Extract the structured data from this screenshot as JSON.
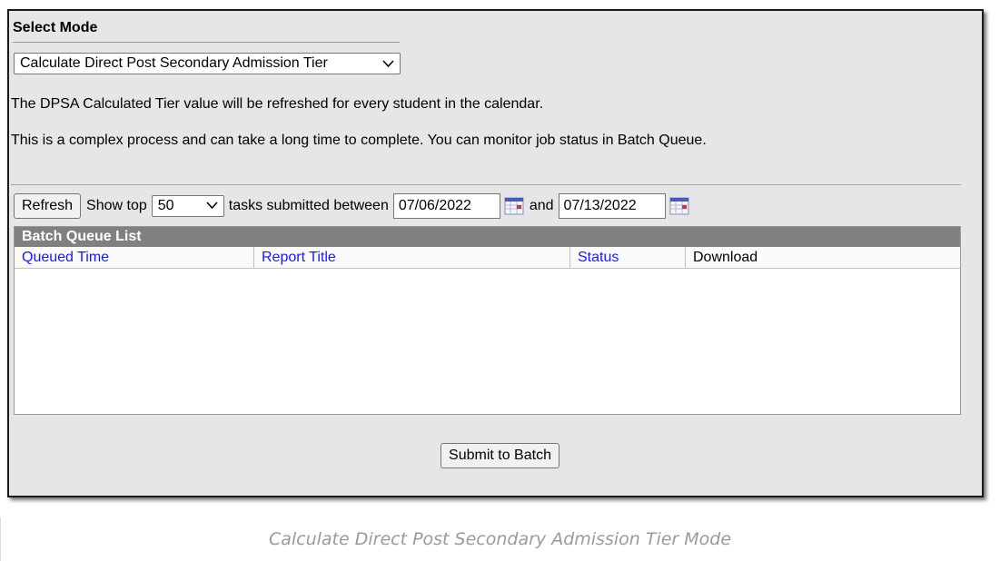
{
  "mode": {
    "header": "Select Mode",
    "selected": "Calculate Direct Post Secondary Admission Tier"
  },
  "messages": {
    "refresh_note": "The DPSA Calculated Tier value will be refreshed for every student in the calendar.",
    "process_note": "This is a complex process and can take a long time to complete. You can monitor job status in Batch Queue."
  },
  "toolbar": {
    "refresh_label": "Refresh",
    "show_top_label": "Show top",
    "top_count": "50",
    "between_label": "tasks submitted between",
    "start_date": "07/06/2022",
    "and_label": "and",
    "end_date": "07/13/2022"
  },
  "batch_queue": {
    "title": "Batch Queue List",
    "columns": [
      "Queued Time",
      "Report Title",
      "Status",
      "Download"
    ],
    "rows": []
  },
  "submit_label": "Submit to Batch",
  "caption": "Calculate Direct Post Secondary Admission Tier Mode",
  "icons": {
    "calendar": "calendar-icon",
    "dropdown": "chevron-down-icon"
  },
  "colors": {
    "link": "#1a1aee",
    "queue_header": "#808080",
    "panel_bg": "#e6e6e6"
  }
}
